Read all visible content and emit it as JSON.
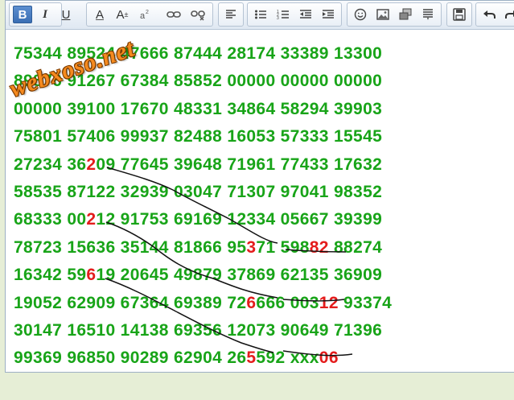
{
  "toolbar": {
    "bold_label": "B",
    "italic_label": "I",
    "underline_label": "U",
    "font_color_label": "A",
    "font_size_label": "A",
    "font_size_sup": "±"
  },
  "watermark": "webxoso.net",
  "lines": [
    {
      "pre": "75344 89524 47666 87444 28174 33389 13300"
    },
    {
      "pre": "89876 91267 67384 85852 00000 00000 00000"
    },
    {
      "pre": "00000 39100 17670 48331 34864 58294 39903"
    },
    {
      "pre": "75801 57406 99937 82488 16053 57333 15545"
    },
    {
      "pre": "27234 36",
      "red": "2",
      "post": "09 77645 39648 71961 77433 17632"
    },
    {
      "pre": "58535 87122 32939 03047 71307 97041 98352"
    },
    {
      "pre": "68333 00",
      "red": "2",
      "post": "12 91753 69169 12334 05667 39399"
    },
    {
      "pre": "78723 15636 35144 81866 95",
      "red": "3",
      "post": "71 598",
      "red2": "82",
      "post2": " 88274"
    },
    {
      "pre": "16342 59",
      "red": "6",
      "post": "19 20645 49879 37869 62135 36909"
    },
    {
      "pre": "19052 62909 67364 69389 72",
      "red": "6",
      "post": "666 003",
      "red2": "12",
      "post2": " 93374"
    },
    {
      "pre": "30147 16510 14138 69356 12073 90649 71396"
    },
    {
      "pre": "99369 96850 90289 62904 26",
      "red": "5",
      "post": "592 xxx",
      "red2": "06",
      "post2": ""
    }
  ]
}
